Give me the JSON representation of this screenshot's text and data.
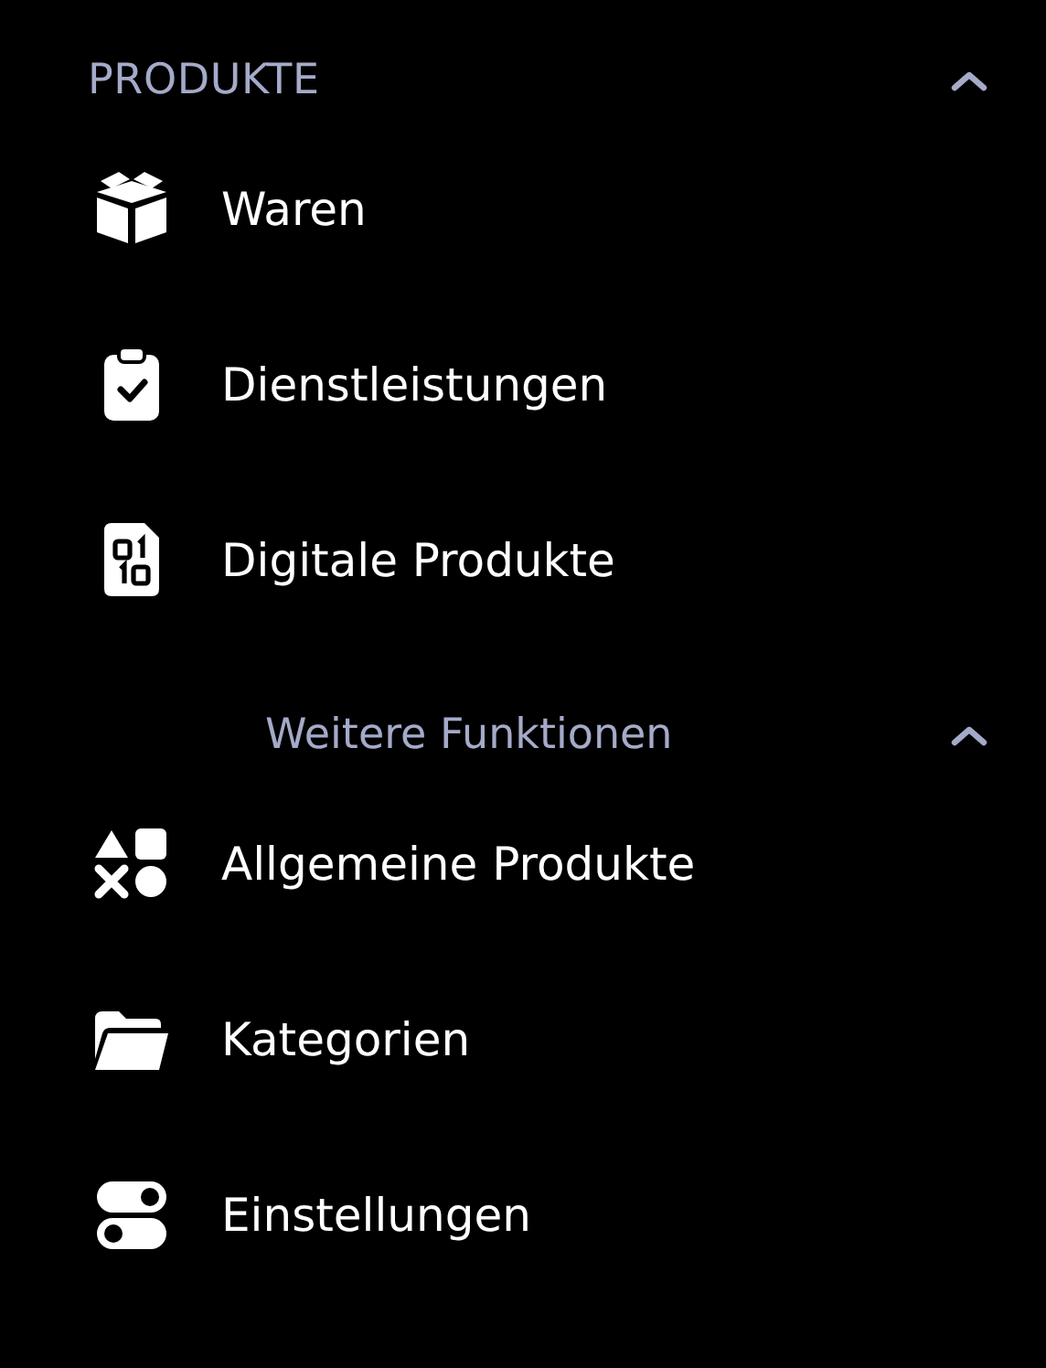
{
  "section": {
    "title": "PRODUKTE",
    "expanded": true,
    "items": [
      {
        "label": "Waren"
      },
      {
        "label": "Dienstleistungen"
      },
      {
        "label": "Digitale Produkte"
      }
    ],
    "subsection": {
      "title": "Weitere Funktionen",
      "expanded": true,
      "items": [
        {
          "label": "Allgemeine Produkte"
        },
        {
          "label": "Kategorien"
        },
        {
          "label": "Einstellungen"
        }
      ]
    }
  }
}
